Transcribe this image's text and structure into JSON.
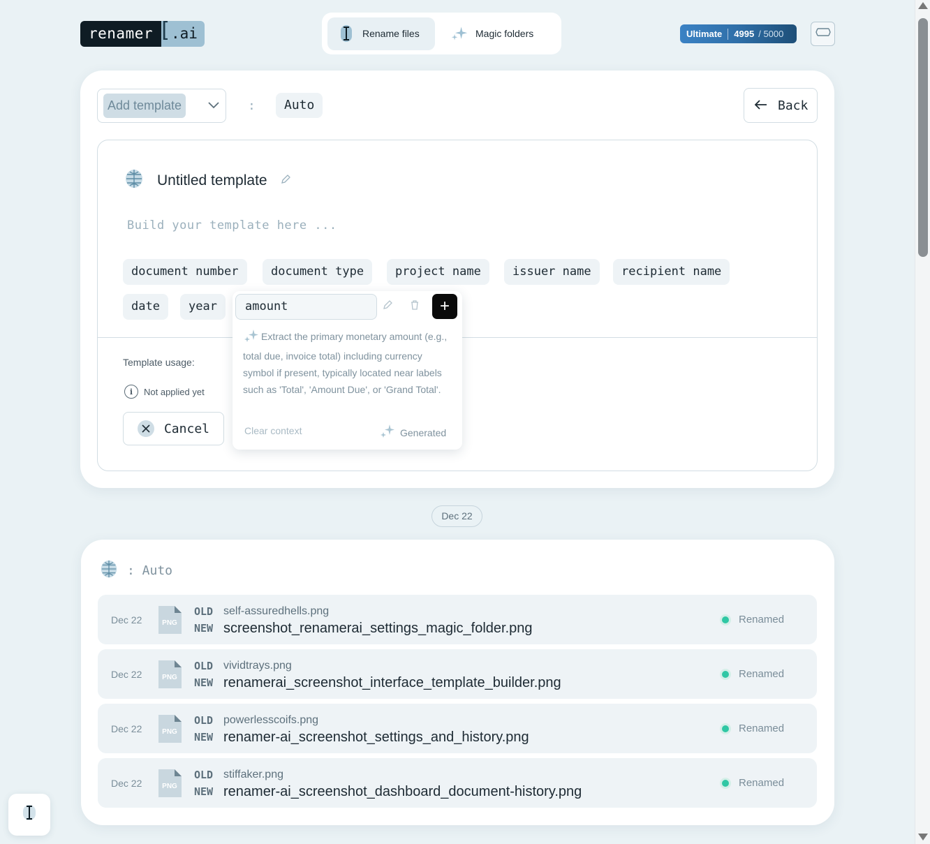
{
  "brand": {
    "name_main": "renamer",
    "name_ext": ".ai"
  },
  "nav": {
    "rename_label": "Rename files",
    "magic_label": "Magic folders"
  },
  "credits": {
    "plan": "Ultimate",
    "used": "4995",
    "total": "/ 5000"
  },
  "toolbar": {
    "template_select_label": "Add template",
    "colon": ":",
    "mode_value": "Auto",
    "back_label": "Back"
  },
  "template": {
    "title": "Untitled template",
    "placeholder": "Build your template here ...",
    "tags": [
      "document number",
      "document type",
      "project name",
      "issuer name",
      "recipient name",
      "date",
      "year"
    ],
    "usage_label": "Template usage:",
    "not_applied": "Not applied yet",
    "cancel_label": "Cancel"
  },
  "popup": {
    "field_value": "amount",
    "description": "Extract the primary monetary amount (e.g., total due, invoice total) including currency symbol if present, typically located near labels such as 'Total', 'Amount Due', or 'Grand Total'.",
    "clear_label": "Clear context",
    "generated_label": "Generated"
  },
  "history": {
    "date_group": "Dec 22",
    "header_label": ": Auto",
    "old_tag": "OLD",
    "new_tag": "NEW",
    "file_type": "PNG",
    "rows": [
      {
        "date": "Dec 22",
        "old": "self-assuredhells.png",
        "new": "screenshot_renamerai_settings_magic_folder.png",
        "status": "Renamed"
      },
      {
        "date": "Dec 22",
        "old": "vividtrays.png",
        "new": "renamerai_screenshot_interface_template_builder.png",
        "status": "Renamed"
      },
      {
        "date": "Dec 22",
        "old": "powerlesscoifs.png",
        "new": "renamer-ai_screenshot_settings_and_history.png",
        "status": "Renamed"
      },
      {
        "date": "Dec 22",
        "old": "stiffaker.png",
        "new": "renamer-ai_screenshot_dashboard_document-history.png",
        "status": "Renamed"
      }
    ]
  },
  "colors": {
    "accent": "#3b82c4",
    "status_ok": "#2fc7a4",
    "background": "#eaf2f5"
  },
  "icons": [
    "cursor-icon",
    "sparkle-icon",
    "menu-icon",
    "chevron-down-icon",
    "arrow-left-icon",
    "brain-icon",
    "pencil-icon",
    "trash-icon",
    "plus-icon",
    "info-icon",
    "close-icon",
    "file-png-icon"
  ]
}
